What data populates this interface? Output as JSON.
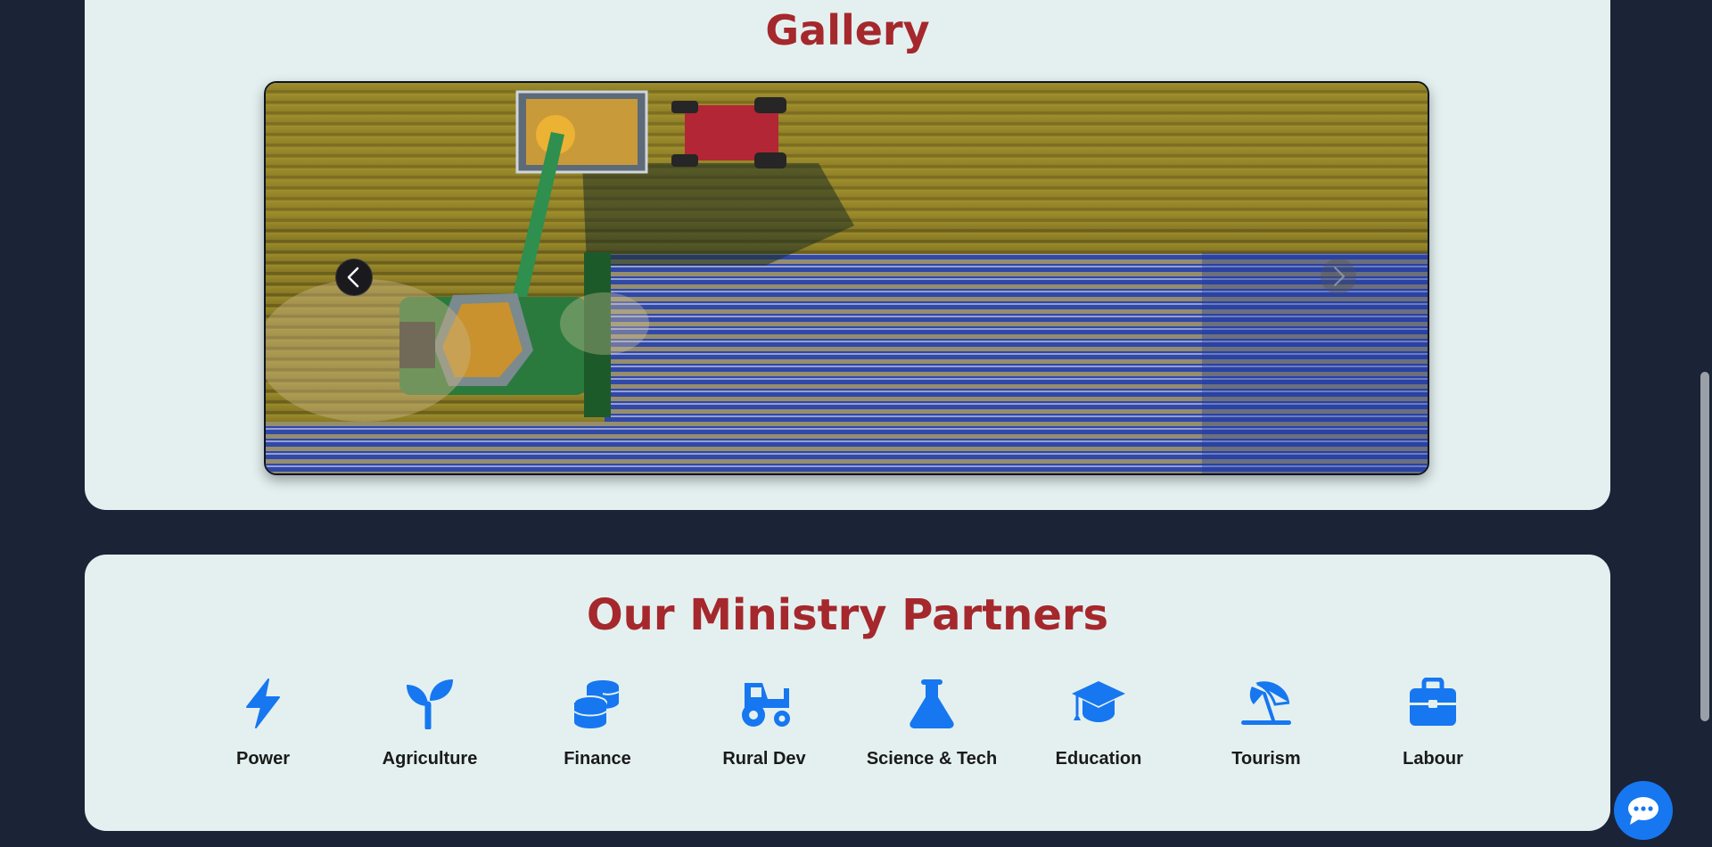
{
  "gallery": {
    "title": "Gallery",
    "slide_description": "Aerial photo of a combine harvester unloading grain into a tractor-pulled trailer in a field"
  },
  "partners": {
    "title": "Our Ministry Partners",
    "items": [
      {
        "label": "Power",
        "icon": "bolt-icon"
      },
      {
        "label": "Agriculture",
        "icon": "seedling-icon"
      },
      {
        "label": "Finance",
        "icon": "coins-icon"
      },
      {
        "label": "Rural Dev",
        "icon": "tractor-icon"
      },
      {
        "label": "Science & Tech",
        "icon": "flask-icon"
      },
      {
        "label": "Education",
        "icon": "graduation-cap-icon"
      },
      {
        "label": "Tourism",
        "icon": "umbrella-beach-icon"
      },
      {
        "label": "Labour",
        "icon": "briefcase-icon"
      }
    ]
  },
  "colors": {
    "page_background": "#1b2336",
    "card_background": "#e4f0f0",
    "heading": "#a5282c",
    "icon_accent": "#1677f0"
  }
}
